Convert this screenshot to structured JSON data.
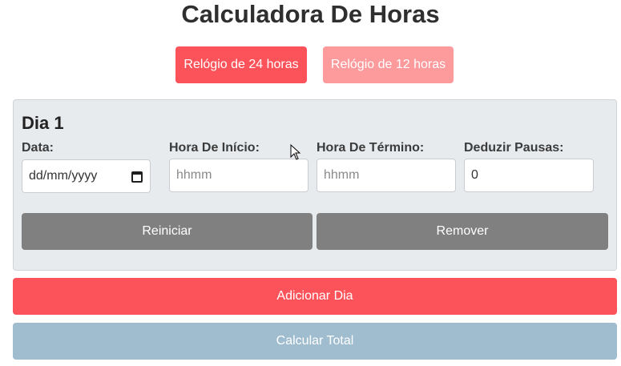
{
  "header": {
    "title": "Calculadora De Horas"
  },
  "modes": {
    "mode_24_label": "Relógio de 24 horas",
    "mode_12_label": "Relógio de 12 horas"
  },
  "day": {
    "title": "Dia 1",
    "date": {
      "label": "Data:",
      "value": "dd/mm/yyyy"
    },
    "start": {
      "label": "Hora De Início:",
      "placeholder": "hhmm"
    },
    "end": {
      "label": "Hora De Término:",
      "placeholder": "hhmm"
    },
    "breaks": {
      "label": "Deduzir Pausas:",
      "value": "0"
    },
    "reset_label": "Reiniciar",
    "remove_label": "Remover"
  },
  "actions": {
    "add_day_label": "Adicionar Dia",
    "calc_total_label": "Calcular Total"
  },
  "colors": {
    "primary_red": "#fc535a",
    "light_red": "#fd9a9c",
    "gray": "#808080",
    "disabled_blue": "#9fbdcf",
    "card_bg": "#e8ebee"
  }
}
